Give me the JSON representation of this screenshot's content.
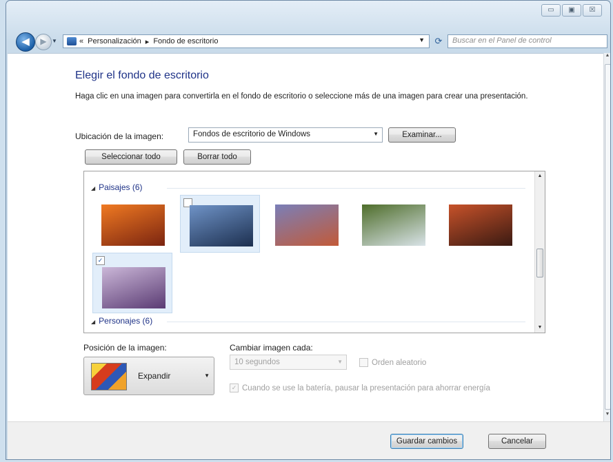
{
  "window": {
    "controls": {
      "minimize": "▭",
      "maximize": "▣",
      "close": "☒"
    }
  },
  "nav": {
    "breadcrumb_prefix": "«",
    "breadcrumb": [
      "Personalización",
      "Fondo de escritorio"
    ],
    "breadcrumb_separator": "▸",
    "search_placeholder": "Buscar en el Panel de control",
    "back_icon": "back-arrow-icon",
    "forward_icon": "forward-arrow-icon"
  },
  "main": {
    "title": "Elegir el fondo de escritorio",
    "description": "Haga clic en una imagen para convertirla en el fondo de escritorio o seleccione más de una imagen para crear una presentación.",
    "location_label": "Ubicación de la imagen:",
    "location_value": "Fondos de escritorio de Windows",
    "browse_button": "Examinar...",
    "select_all_button": "Seleccionar todo",
    "clear_all_button": "Borrar todo"
  },
  "gallery": {
    "groups": [
      {
        "name": "Paisajes (6)",
        "images": [
          {
            "checked": false,
            "selected": false,
            "colors": [
              "#f07a22",
              "#7a2410"
            ]
          },
          {
            "checked": false,
            "selected": true,
            "colors": [
              "#6f93c7",
              "#1c2f4f"
            ]
          },
          {
            "checked": false,
            "selected": false,
            "colors": [
              "#7a7fb8",
              "#c25a38"
            ]
          },
          {
            "checked": false,
            "selected": false,
            "colors": [
              "#4e6d2a",
              "#d9e3e8"
            ]
          },
          {
            "checked": false,
            "selected": false,
            "colors": [
              "#c7522a",
              "#3a1a12"
            ]
          },
          {
            "checked": true,
            "selected": true,
            "colors": [
              "#cbb7d8",
              "#5a3b73"
            ]
          }
        ]
      },
      {
        "name": "Personajes (6)",
        "images": []
      }
    ]
  },
  "position": {
    "label": "Posición de la imagen:",
    "value": "Expandir"
  },
  "interval": {
    "label": "Cambiar imagen cada:",
    "value": "10 segundos",
    "shuffle_label": "Orden aleatorio",
    "battery_label": "Cuando se use la batería, pausar la presentación para ahorrar energía"
  },
  "footer": {
    "save_button": "Guardar cambios",
    "cancel_button": "Cancelar"
  }
}
